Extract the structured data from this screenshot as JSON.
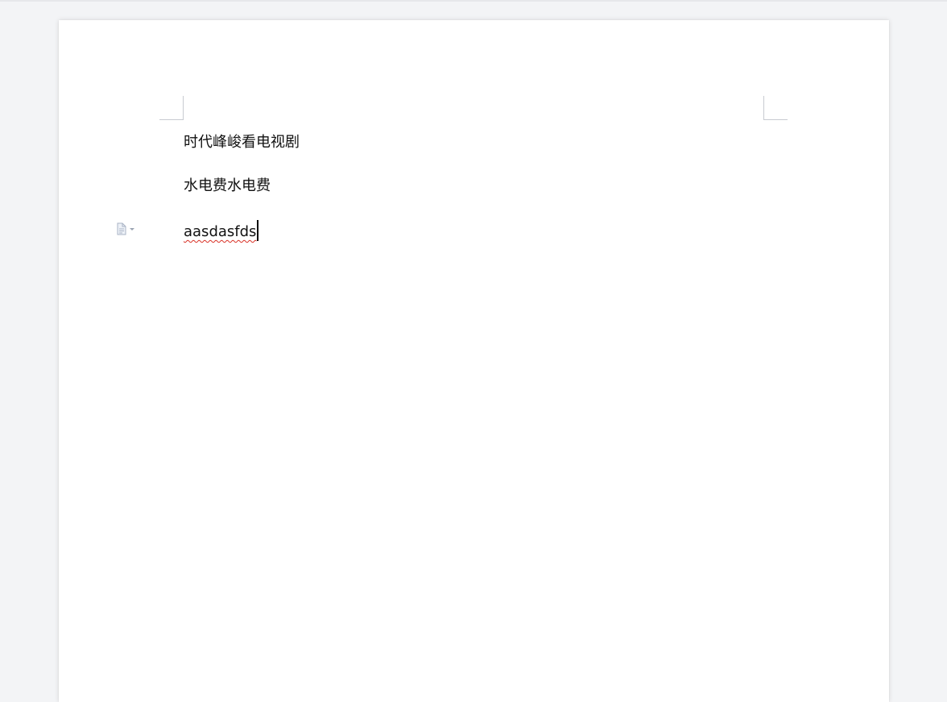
{
  "document": {
    "paragraphs": [
      "时代峰峻看电视剧",
      "水电费水电费",
      "aasdasfds"
    ]
  },
  "paragraph_handle": {
    "icon": "document-icon",
    "dropdown_icon": "chevron-down-icon"
  },
  "colors": {
    "workspace_background": "#f3f4f6",
    "page_background": "#ffffff",
    "text": "#111111",
    "spellcheck_underline": "#d93025"
  }
}
